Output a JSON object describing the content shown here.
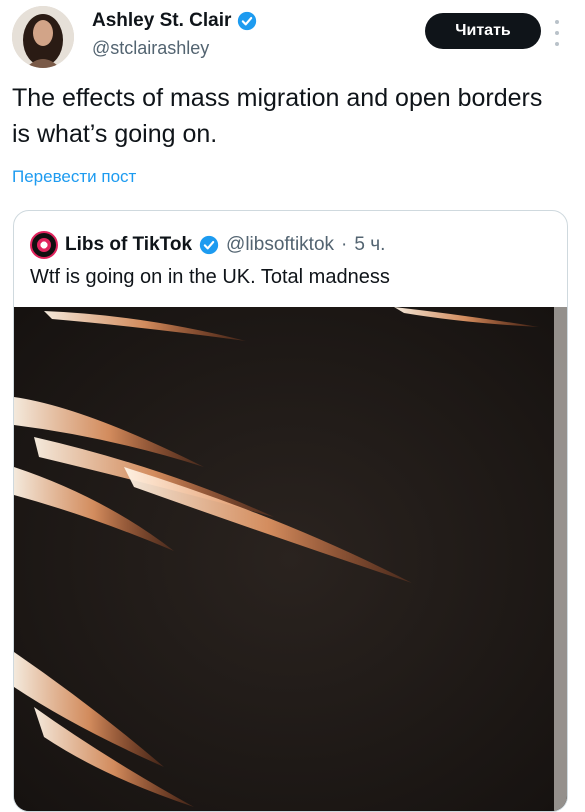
{
  "author": {
    "name": "Ashley St. Clair",
    "handle": "@stclairashley",
    "verified_icon": "verified-badge-icon",
    "follow_label": "Читать"
  },
  "tweet": {
    "text": "The effects of mass migration and open borders is what’s going on.",
    "translate_label": "Перевести пост"
  },
  "quote": {
    "name": "Libs of TikTok",
    "handle": "@libsoftiktok",
    "separator": "·",
    "time": "5 ч.",
    "text": "Wtf is going on in the UK. Total madness"
  },
  "colors": {
    "accent": "#1d9bf0",
    "text": "#0f1419",
    "secondary": "#536471",
    "video_bg": "#1f1a17"
  }
}
